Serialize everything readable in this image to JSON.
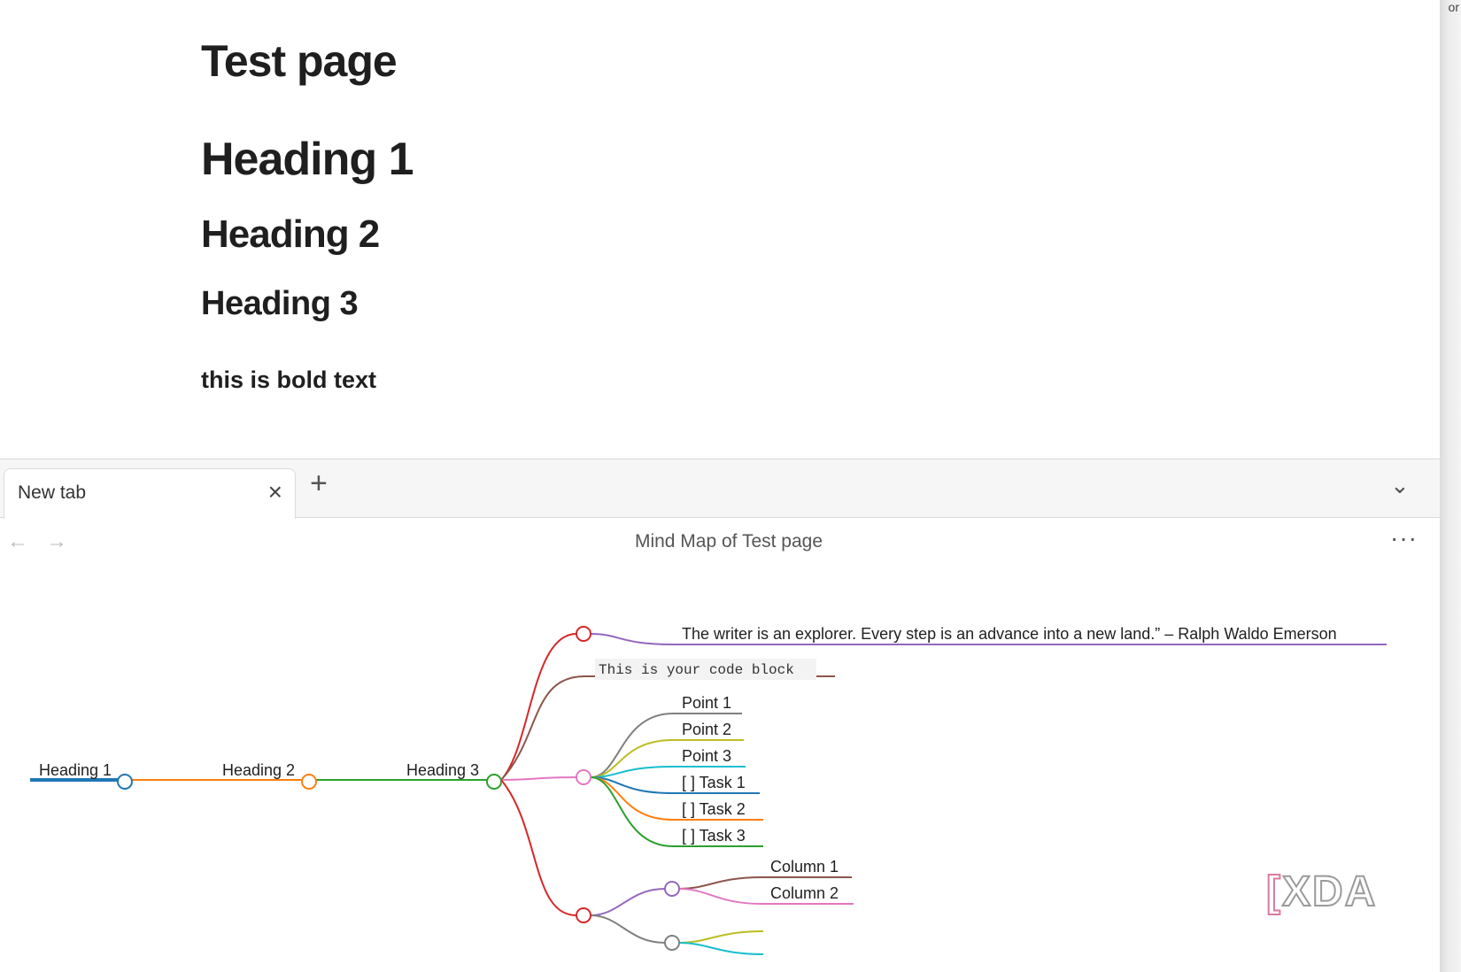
{
  "editor": {
    "title": "Test page",
    "heading1": "Heading 1",
    "heading2": "Heading 2",
    "heading3": "Heading 3",
    "bold_text": "this is bold text"
  },
  "corner_text": "or",
  "tabs": [
    {
      "label": "New tab",
      "close_icon": "close-icon"
    }
  ],
  "tabbar": {
    "add_icon": "plus-icon",
    "menu_icon": "chevron-down-icon"
  },
  "nav": {
    "back_icon": "arrow-left-icon",
    "forward_icon": "arrow-right-icon",
    "page_title": "Mind Map of Test page",
    "more_icon": "more-horizontal-icon"
  },
  "mindmap": {
    "nodes": {
      "h1": "Heading 1",
      "h2": "Heading 2",
      "h3": "Heading 3",
      "quote": "The writer is an explorer. Every step is an advance into a new land.” – Ralph Waldo Emerson",
      "code": "This is your code block",
      "point1": "Point 1",
      "point2": "Point 2",
      "point3": "Point 3",
      "task1": "[ ] Task 1",
      "task2": "[ ] Task 2",
      "task3": "[ ] Task 3",
      "col1": "Column 1",
      "col2": "Column 2"
    },
    "colors": {
      "blue": "#1f77b4",
      "orange": "#ff7f0e",
      "green": "#2ca02c",
      "red": "#d62728",
      "purple": "#9467bd",
      "brown": "#8c564b",
      "pink": "#e377c2",
      "gray": "#7f7f7f",
      "olive": "#bcbd22",
      "cyan": "#17becf"
    }
  },
  "watermark": {
    "text": "XDA",
    "bracket": "["
  }
}
